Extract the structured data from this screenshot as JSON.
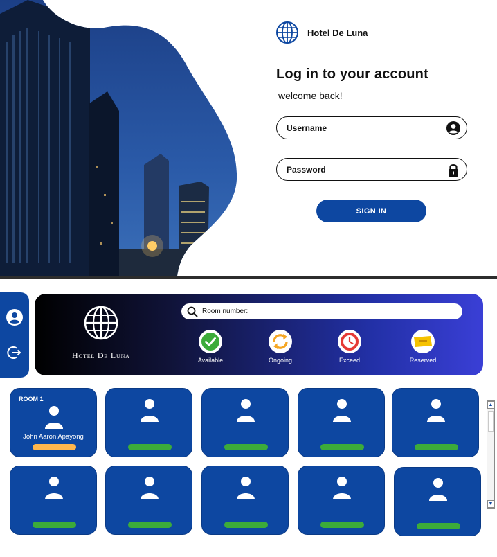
{
  "login": {
    "brand": "Hotel De Luna",
    "title": "Log in to your account",
    "subtitle": "welcome back!",
    "username_placeholder": "Username",
    "password_placeholder": "Password",
    "signin_label": "SIGN IN"
  },
  "dashboard": {
    "brand": "Hotel De Luna",
    "search_placeholder": "Room number:",
    "statuses": [
      {
        "label": "Available",
        "icon": "check-icon",
        "color": "#3cab3a"
      },
      {
        "label": "Ongoing",
        "icon": "sync-icon",
        "color": "#f5a623"
      },
      {
        "label": "Exceed",
        "icon": "clock-icon",
        "color": "#e53935"
      },
      {
        "label": "Reserved",
        "icon": "ticket-icon",
        "color": "#f6c200"
      }
    ],
    "rooms": [
      {
        "label": "ROOM 1",
        "guest": "John Aaron Apayong",
        "status": "ongoing"
      },
      {
        "label": "",
        "guest": "",
        "status": "available"
      },
      {
        "label": "",
        "guest": "",
        "status": "available"
      },
      {
        "label": "",
        "guest": "",
        "status": "available"
      },
      {
        "label": "",
        "guest": "",
        "status": "available"
      },
      {
        "label": "",
        "guest": "",
        "status": "available"
      },
      {
        "label": "",
        "guest": "",
        "status": "available"
      },
      {
        "label": "",
        "guest": "",
        "status": "available"
      },
      {
        "label": "",
        "guest": "",
        "status": "available"
      },
      {
        "label": "",
        "guest": "",
        "status": "available"
      }
    ]
  },
  "colors": {
    "primary": "#0d47a1",
    "available": "#3cab3a",
    "ongoing": "#ffb74d"
  }
}
